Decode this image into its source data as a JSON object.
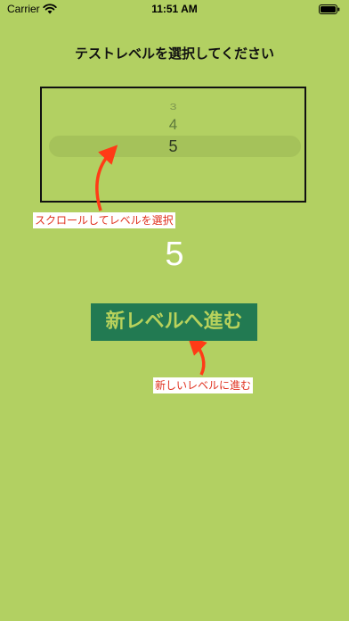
{
  "status_bar": {
    "carrier": "Carrier",
    "time": "11:51 AM",
    "wifi_icon": "wifi-icon",
    "battery_icon": "battery-icon"
  },
  "title": "テストレベルを選択してください",
  "picker": {
    "items": [
      "3",
      "4",
      "5"
    ],
    "selected": "5"
  },
  "hints": {
    "scroll": "スクロールしてレベルを選択",
    "next": "新しいレベルに進む"
  },
  "level_display": "5",
  "next_button_label": "新レベルへ進む",
  "colors": {
    "background": "#b2d062",
    "button_bg": "#227a52",
    "button_text": "#b8d25c",
    "hint_text": "#e0301e",
    "arrow": "#ff3b16"
  }
}
